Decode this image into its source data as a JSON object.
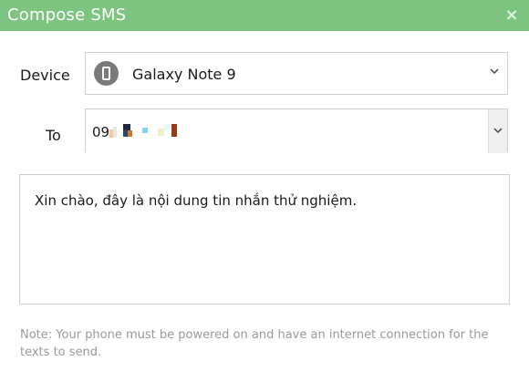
{
  "window": {
    "title": "Compose SMS",
    "close_label": "×"
  },
  "device": {
    "label": "Device",
    "selected": "Galaxy Note 9",
    "icon": "phone-icon"
  },
  "recipient": {
    "label": "To",
    "value_prefix": "09"
  },
  "message": {
    "text": "Xin chào, đây là nội dung tin nhắn thử nghiệm."
  },
  "note": "Note: Your phone must be powered on and have an internet connection for the texts to send.",
  "colors": {
    "titlebar": "#7cc47f",
    "border": "#cfcfcf",
    "note_text": "#9a9a9a"
  }
}
